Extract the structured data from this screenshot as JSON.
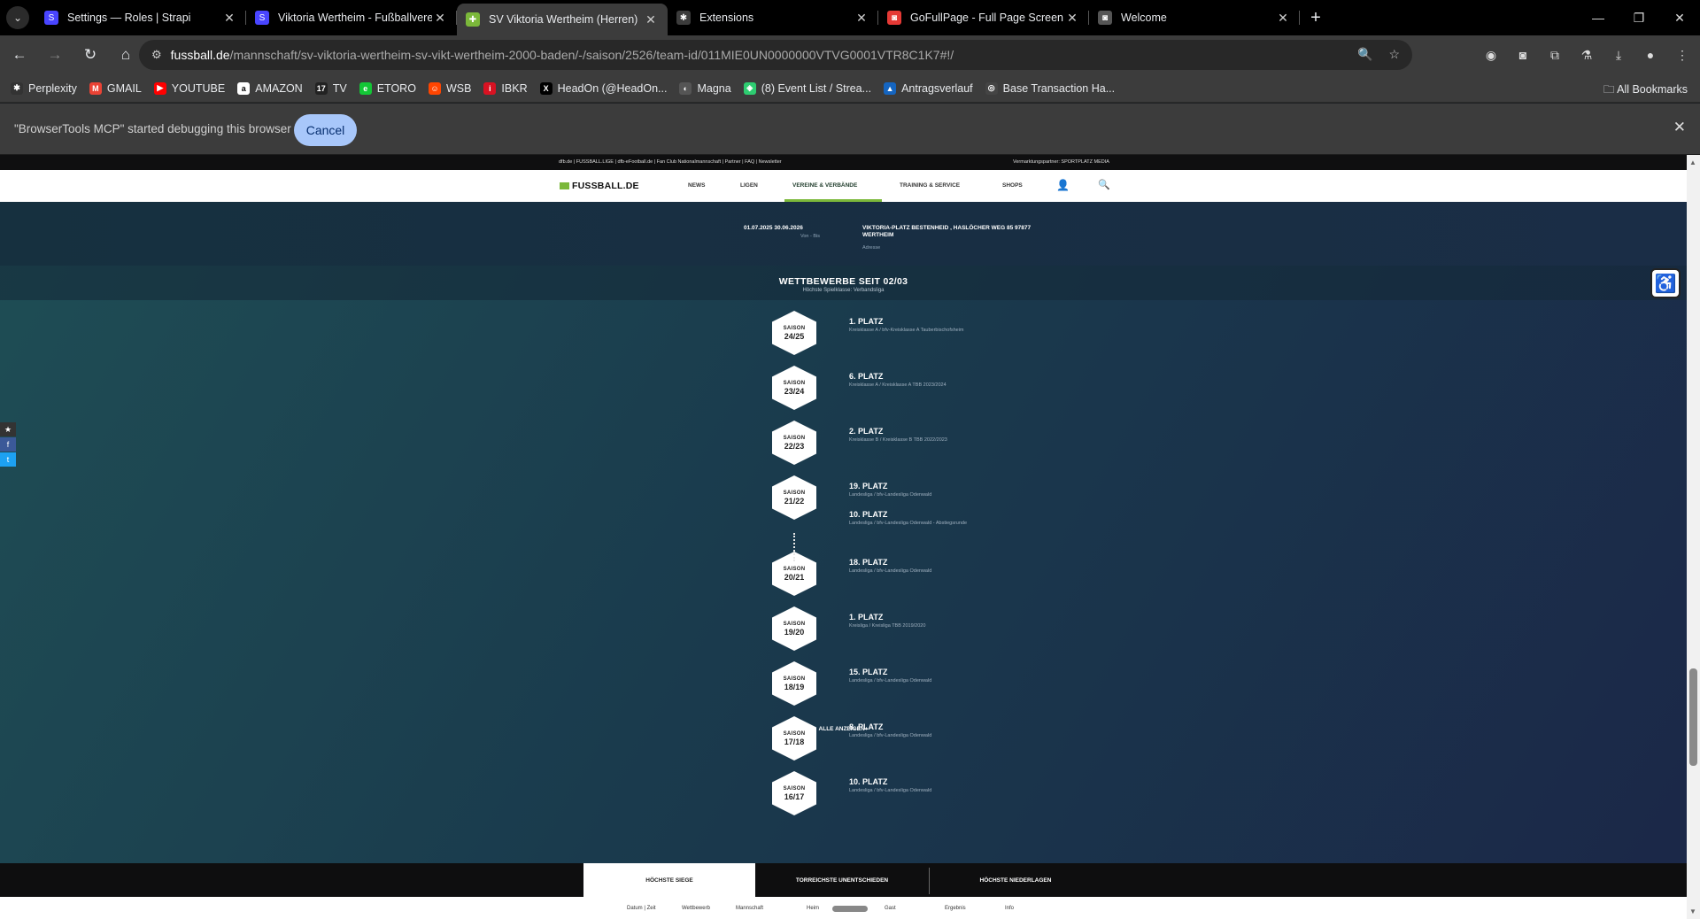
{
  "browser": {
    "tabs": [
      {
        "title": "Settings — Roles | Strapi",
        "favicon_color": "#4945ff",
        "favicon_glyph": "S"
      },
      {
        "title": "Viktoria Wertheim - Fußballvere",
        "favicon_color": "#4945ff",
        "favicon_glyph": "S"
      },
      {
        "title": "SV Viktoria Wertheim (Herren)",
        "favicon_color": "#7bb83a",
        "favicon_glyph": "✚",
        "active": true
      },
      {
        "title": "Extensions",
        "favicon_color": "#3c3c3c",
        "favicon_glyph": "puzzle-icon"
      },
      {
        "title": "GoFullPage - Full Page Screen C",
        "favicon_color": "#e53935",
        "favicon_glyph": "camera-icon"
      },
      {
        "title": "Welcome",
        "favicon_color": "#555555",
        "favicon_glyph": "camera-icon"
      }
    ],
    "url_domain": "fussball.de",
    "url_path": "/mannschaft/sv-viktoria-wertheim-sv-vikt-wertheim-2000-baden/-/saison/2526/team-id/011MIE0UN0000000VTVG0001VTR8C1K7#!/",
    "bookmarks": [
      {
        "label": "Perplexity",
        "color": "#333333",
        "glyph": "✱"
      },
      {
        "label": "GMAIL",
        "color": "#ea4335",
        "glyph": "M"
      },
      {
        "label": "YOUTUBE",
        "color": "#ff0000",
        "glyph": "▶"
      },
      {
        "label": "AMAZON",
        "color": "#ffffff",
        "glyph": "a"
      },
      {
        "label": "TV",
        "color": "#222222",
        "glyph": "17"
      },
      {
        "label": "ETORO",
        "color": "#13c636",
        "glyph": "e"
      },
      {
        "label": "WSB",
        "color": "#ff4500",
        "glyph": "☺"
      },
      {
        "label": "IBKR",
        "color": "#d81222",
        "glyph": "i"
      },
      {
        "label": "HeadOn (@HeadOn...",
        "color": "#000000",
        "glyph": "X"
      },
      {
        "label": "Magna",
        "color": "#555555",
        "glyph": "◐"
      },
      {
        "label": "(8) Event List / Strea...",
        "color": "#2ecc71",
        "glyph": "◈"
      },
      {
        "label": "Antragsverlauf",
        "color": "#1565c0",
        "glyph": "▲"
      },
      {
        "label": "Base Transaction Ha...",
        "color": "#444444",
        "glyph": "◎"
      }
    ],
    "all_bookmarks": "All Bookmarks",
    "infobar": {
      "message": "\"BrowserTools MCP\" started debugging this browser",
      "cancel": "Cancel"
    }
  },
  "site": {
    "top_links": "dfb.de  |  FUSSBALL.LIGE  |  dfb-eFootball.de  |  Fan Club Nationalmannschaft  |  Partner  |  FAQ  |  Newsletter",
    "partner": "Vermarktungspartner: SPORTPLATZ MEDIA",
    "logo": "FUSSBALL.DE",
    "nav": [
      "NEWS",
      "LIGEN",
      "VEREINE & VERBÄNDE",
      "TRAINING & SERVICE",
      "SHOPS"
    ],
    "hero": {
      "dates": "01.07.2025  30.06.2026",
      "dates_label": "Von - Bis",
      "address": "VIKTORIA-PLATZ BESTENHEID , HASLÖCHER WEG 85 97877   WERTHEIM",
      "address_label": "Adresse"
    },
    "competitions": {
      "title": "WETTBEWERBE SEIT 02/03",
      "subtitle": "Höchste Spielklasse: Verbandsliga",
      "season_label": "SAISON",
      "seasons": [
        {
          "year": "24/25",
          "entries": [
            {
              "place": "1. PLATZ",
              "league": "Kreisklasse A / bfv-Kreisklasse A Tauberbischofsheim"
            }
          ]
        },
        {
          "year": "23/24",
          "entries": [
            {
              "place": "6. PLATZ",
              "league": "Kreisklasse A / Kreisklasse A TBB 2023/2024"
            }
          ]
        },
        {
          "year": "22/23",
          "entries": [
            {
              "place": "2. PLATZ",
              "league": "Kreisklasse B / Kreisklasse B TBB 2022/2023"
            }
          ]
        },
        {
          "year": "21/22",
          "entries": [
            {
              "place": "19. PLATZ",
              "league": "Landesliga / bfv-Landesliga Odenwald"
            },
            {
              "place": "10. PLATZ",
              "league": "Landesliga / bfv-Landesliga Odenwald - Abstiegsrunde"
            }
          ]
        },
        {
          "year": "20/21",
          "entries": [
            {
              "place": "18. PLATZ",
              "league": "Landesliga / bfv-Landesliga Odenwald"
            }
          ]
        },
        {
          "year": "19/20",
          "entries": [
            {
              "place": "1. PLATZ",
              "league": "Kreisliga / Kreisliga TBB 2019/2020"
            }
          ]
        },
        {
          "year": "18/19",
          "entries": [
            {
              "place": "15. PLATZ",
              "league": "Landesliga / bfv-Landesliga Odenwald"
            }
          ]
        },
        {
          "year": "17/18",
          "entries": [
            {
              "place": "8. PLATZ",
              "league": "Landesliga / bfv-Landesliga Odenwald"
            }
          ]
        },
        {
          "year": "16/17",
          "entries": [
            {
              "place": "10. PLATZ",
              "league": "Landesliga / bfv-Landesliga Odenwald"
            }
          ]
        }
      ],
      "show_all": "ALLE ANZEIGEN+"
    },
    "bottom_tabs": [
      "HÖCHSTE SIEGE",
      "TORREICHSTE UNENTSCHIEDEN",
      "HÖCHSTE NIEDERLAGEN"
    ],
    "table_headers": [
      "Datum | Zeit",
      "Wettbewerb",
      "Mannschaft",
      "Heim",
      "Gast",
      "Ergebnis",
      "Info"
    ]
  }
}
